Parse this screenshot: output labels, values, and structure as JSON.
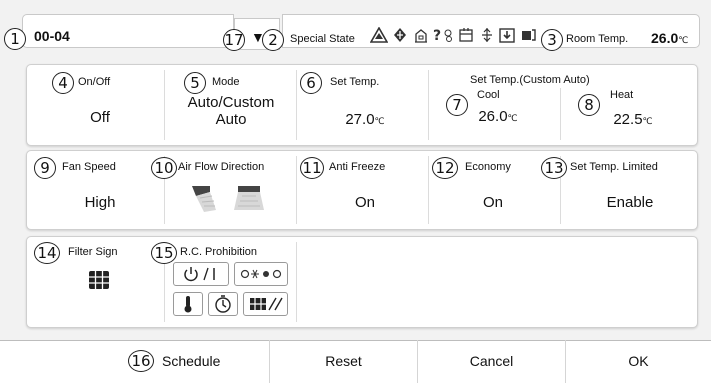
{
  "callouts": [
    "1",
    "2",
    "3",
    "4",
    "5",
    "6",
    "7",
    "8",
    "9",
    "10",
    "11",
    "12",
    "13",
    "14",
    "15",
    "16",
    "17"
  ],
  "header": {
    "unit_name": "00-04",
    "dropdown_arrow": "▼",
    "special_state_label": "Special State",
    "special_state_icons": [
      "warning-triangle-icon",
      "defrost-icon",
      "building-icon",
      "question-settings-icon",
      "timer-icon",
      "lever-icon",
      "download-icon",
      "fan-flag-icon"
    ],
    "special_state_glyphs": [
      "⧍",
      "♦",
      "⌂",
      "?",
      "⊡",
      "⟡",
      "⊻",
      "◈"
    ],
    "room_temp_label": "Room Temp.",
    "room_temp_value": "26.0",
    "room_temp_unit": "℃"
  },
  "row1": {
    "onoff_label": "On/Off",
    "onoff_value": "Off",
    "mode_label": "Mode",
    "mode_value_line1": "Auto/Custom",
    "mode_value_line2": "Auto",
    "set_temp_label": "Set Temp.",
    "set_temp_value": "27.0",
    "set_temp_unit": "℃",
    "custom_auto_label": "Set Temp.(Custom Auto)",
    "cool_label": "Cool",
    "cool_value": "26.0",
    "cool_unit": "℃",
    "heat_label": "Heat",
    "heat_value": "22.5",
    "heat_unit": "℃"
  },
  "row2": {
    "fan_speed_label": "Fan Speed",
    "fan_speed_value": "High",
    "air_flow_label": "Air Flow Direction",
    "anti_freeze_label": "Anti Freeze",
    "anti_freeze_value": "On",
    "economy_label": "Economy",
    "economy_value": "On",
    "set_temp_limited_label": "Set Temp. Limited",
    "set_temp_limited_value": "Enable"
  },
  "row3": {
    "filter_sign_label": "Filter Sign",
    "rc_prohibition_label": "R.C. Prohibition",
    "rc_buttons": [
      {
        "glyph": "⏻/|",
        "icon": "power-icon"
      },
      {
        "glyph": "☼❄♨☼",
        "icon": "mode-icons"
      },
      {
        "glyph": "🌡",
        "icon": "thermometer-icon"
      },
      {
        "glyph": "⏲",
        "icon": "timer-icon"
      },
      {
        "glyph": "▦⁄⁄",
        "icon": "filter-fan-icon"
      }
    ]
  },
  "footer": {
    "schedule": "Schedule",
    "reset": "Reset",
    "cancel": "Cancel",
    "ok": "OK"
  },
  "colors": {
    "panel_bg": "#ffffff",
    "screen_bg": "#f2f2f2",
    "border": "#cfcfcf"
  }
}
